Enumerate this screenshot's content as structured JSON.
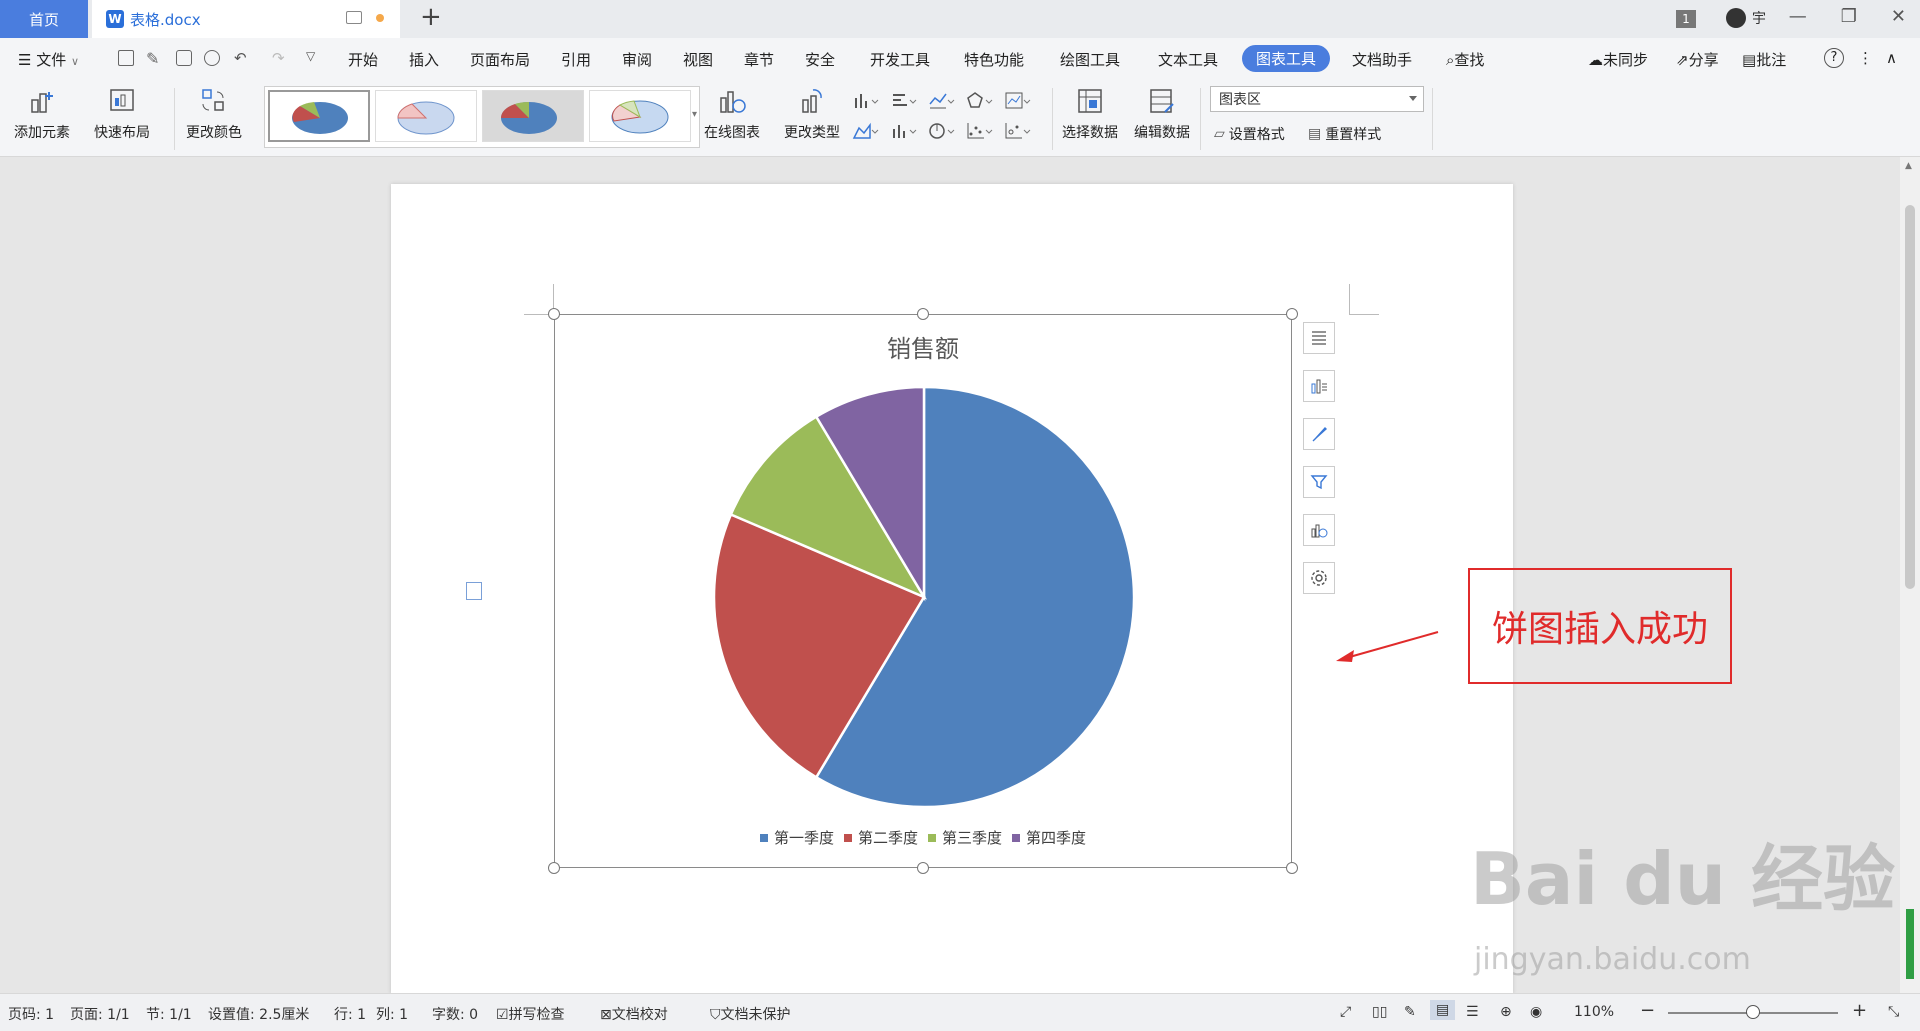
{
  "titlebar": {
    "home_tab": "首页",
    "doc_tab": "表格.docx",
    "doc_icon": "W",
    "new_tab": "+",
    "window_count": "1",
    "user_name": "宇",
    "minimize": "—",
    "restore": "❐",
    "close": "✕"
  },
  "menubar": {
    "file": "文件",
    "tabs": [
      "开始",
      "插入",
      "页面布局",
      "引用",
      "审阅",
      "视图",
      "章节",
      "安全",
      "开发工具",
      "特色功能",
      "绘图工具",
      "文本工具",
      "图表工具",
      "文档助手"
    ],
    "active_tab": "图表工具",
    "search": "查找",
    "sync": "未同步",
    "share": "分享",
    "comment": "批注",
    "help": "?"
  },
  "ribbon": {
    "add_element": "添加元素",
    "quick_layout": "快速布局",
    "change_color": "更改颜色",
    "online_chart": "在线图表",
    "change_type": "更改类型",
    "select_data": "选择数据",
    "edit_data": "编辑数据",
    "area_select": "图表区",
    "set_format": "设置格式",
    "reset_style": "重置样式"
  },
  "chart_data": {
    "type": "pie",
    "title": "销售额",
    "categories": [
      "第一季度",
      "第二季度",
      "第三季度",
      "第四季度"
    ],
    "values": [
      8.2,
      3.2,
      1.4,
      1.2
    ],
    "colors": [
      "#4f81bd",
      "#c0504d",
      "#9bbb59",
      "#8064a2"
    ],
    "legend": "bottom"
  },
  "annotation": {
    "callout_text": "饼图插入成功",
    "color": "#e02b2b"
  },
  "statusbar": {
    "page_num": "页码: 1",
    "pages": "页面: 1/1",
    "section": "节: 1/1",
    "setting": "设置值: 2.5厘米",
    "row": "行: 1",
    "col": "列: 1",
    "word_count": "字数: 0",
    "spell_check": "拼写检查",
    "doc_proof": "文档校对",
    "doc_protect": "文档未保护",
    "zoom": "110%"
  },
  "watermark": {
    "main": "Bai du 经验",
    "sub": "jingyan.baidu.com"
  }
}
